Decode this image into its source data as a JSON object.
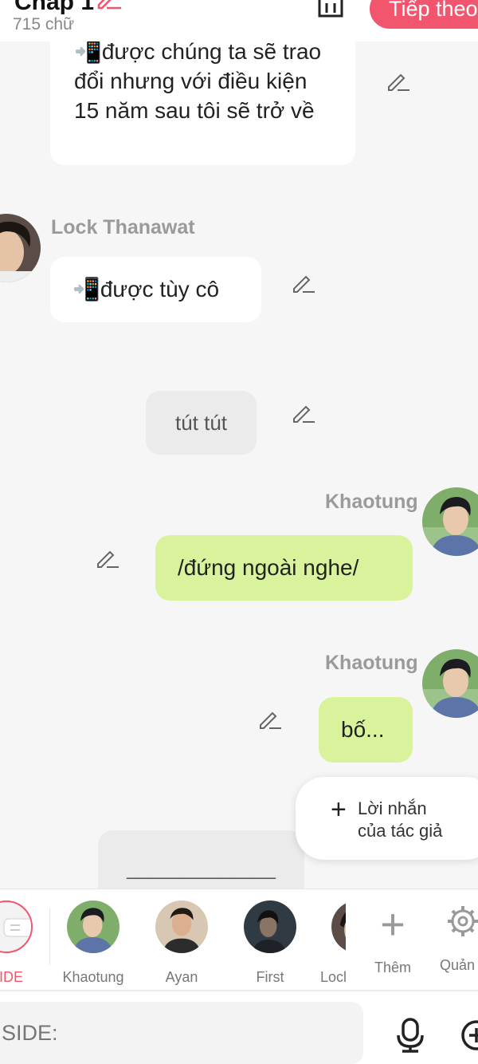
{
  "header": {
    "chapter_title": "Chap 1",
    "word_count": "715 chữ",
    "next_button": "Tiếp theo"
  },
  "messages": [
    {
      "text": "📲được chúng ta sẽ trao đổi nhưng với điều kiện 15 năm sau tôi sẽ trở về"
    },
    {
      "sender": "Lock Thanawat",
      "text": "📲được tùy cô"
    },
    {
      "text": "tút tút"
    },
    {
      "sender": "Khaotung",
      "text": "/đứng ngoài nghe/"
    },
    {
      "sender": "Khaotung",
      "text": "bố..."
    },
    {
      "text": "______________"
    }
  ],
  "author_note": {
    "line1": "Lời nhắn",
    "line2": "của tác giả"
  },
  "character_bar": {
    "items": [
      {
        "label": "SIDE"
      },
      {
        "label": "Khaotung"
      },
      {
        "label": "Ayan"
      },
      {
        "label": "First"
      },
      {
        "label": "Locl"
      },
      {
        "label": "Thêm"
      },
      {
        "label": "Quản l"
      }
    ]
  },
  "input": {
    "placeholder": "SIDE:"
  },
  "colors": {
    "accent": "#f2566e",
    "green_bubble": "#d8f39b",
    "grey_bubble": "#ebebeb"
  }
}
